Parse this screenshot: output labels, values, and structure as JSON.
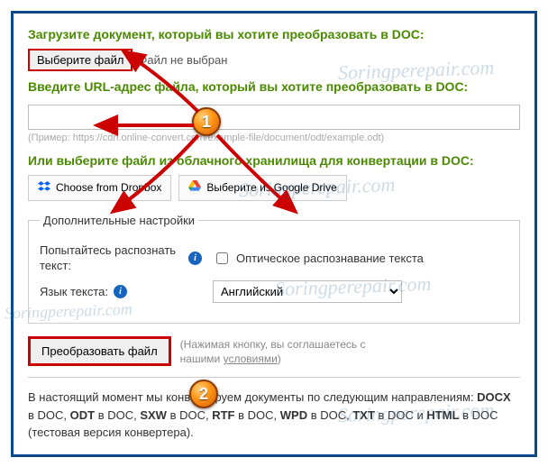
{
  "upload": {
    "heading": "Загрузите документ, который вы хотите преобразовать в DOC:",
    "choose_file_label": "Выберите файл",
    "no_file_text": "Файл не выбран"
  },
  "url": {
    "heading": "Введите URL-адрес файла, который вы хотите преобразовать в DOC:",
    "value": "",
    "example": "(Пример: https://cdn.online-convert.com/example-file/document/odt/example.odt)"
  },
  "cloud": {
    "heading": "Или выберите файл из облачного хранилища для конвертации в DOC:",
    "dropbox_label": "Choose from Dropbox",
    "gdrive_label": "Выберите из Google Drive"
  },
  "advanced": {
    "legend": "Дополнительные настройки",
    "ocr_label": "Попытайтесь распознать текст:",
    "ocr_checkbox_label": "Оптическое распознавание текста",
    "ocr_checked": false,
    "lang_label": "Язык текста:",
    "lang_selected": "Английский"
  },
  "submit": {
    "convert_label": "Преобразовать файл",
    "agree_prefix": "(Нажимая кнопку, вы соглашаетесь с нашими ",
    "terms_link": "условиями",
    "agree_suffix": ")"
  },
  "footer": {
    "text_parts": [
      "В настоящий момент мы конвертируем документы по следующим направлениям: ",
      "DOCX",
      " в DOC, ",
      "ODT",
      " в DOC, ",
      "SXW",
      " в DOC, ",
      "RTF",
      " в DOC, ",
      "WPD",
      " в DOC, ",
      "TXT",
      " в DOC и ",
      "HTML",
      " в DOC (тестовая версия конвертера)."
    ]
  },
  "annotations": {
    "marker1": "1",
    "marker2": "2",
    "watermark": "Soringperepair.com"
  },
  "colors": {
    "accent_green": "#4a8a00",
    "highlight_red": "#c00",
    "frame_blue": "#0a4a8a"
  }
}
